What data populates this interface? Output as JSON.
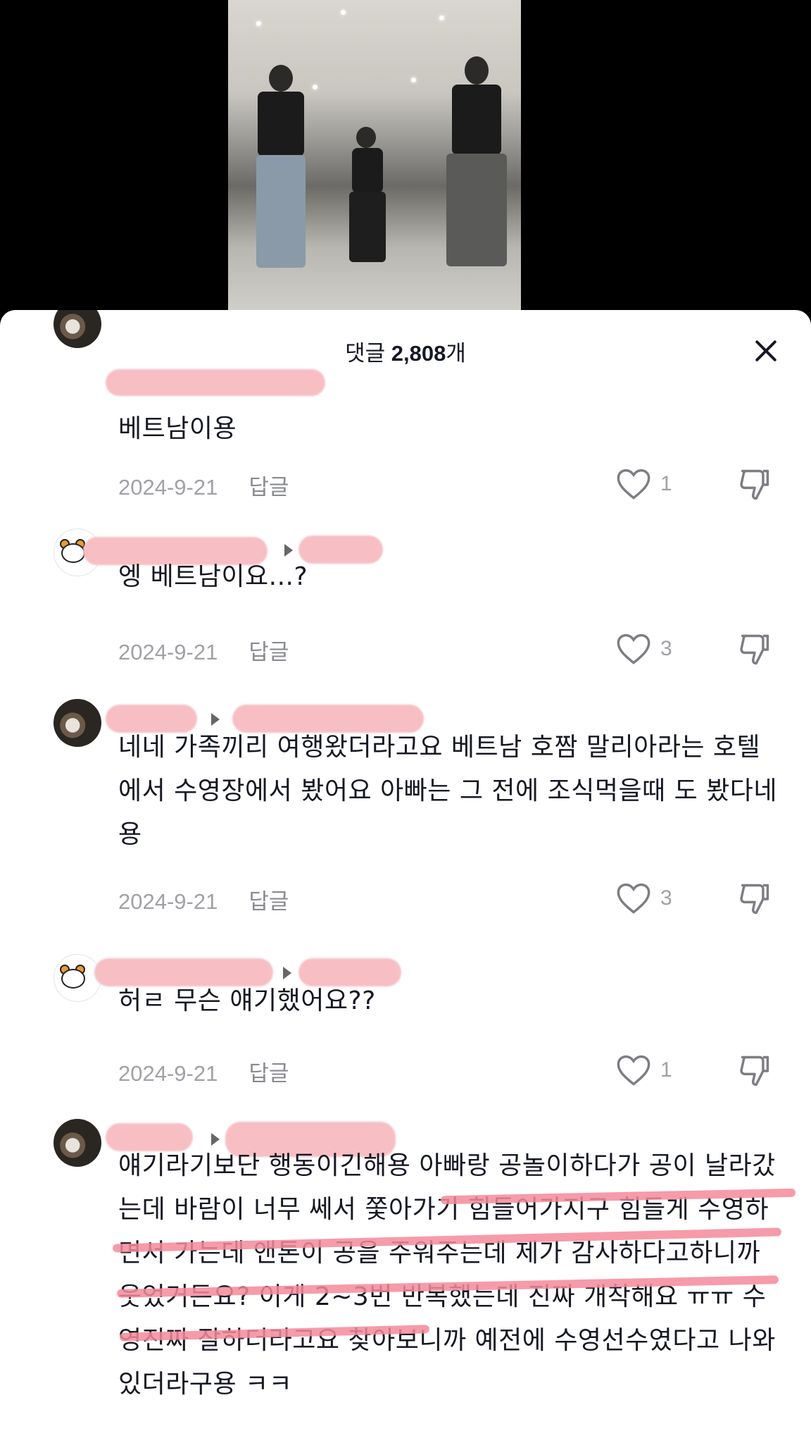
{
  "sheet": {
    "title_prefix": "댓글",
    "title_count": "2,808",
    "title_suffix": "개"
  },
  "icons": {
    "close": "close-icon",
    "like": "heart-icon",
    "dislike": "thumbs-down-icon",
    "reply_arrow": "play-arrow-icon"
  },
  "comments": [
    {
      "text": "베트남이용",
      "date": "2024-9-21",
      "reply_label": "답글",
      "likes": "1"
    },
    {
      "text": "엥 베트남이요...?",
      "date": "2024-9-21",
      "reply_label": "답글",
      "likes": "3"
    },
    {
      "text": "네네 가족끼리 여행왔더라고요 베트남 호짬 말리아라는 호텔에서 수영장에서 봤어요 아빠는 그 전에 조식먹을때 도 봤다네용",
      "date": "2024-9-21",
      "reply_label": "답글",
      "likes": "3"
    },
    {
      "text": "허ㄹ 무슨 얘기했어요??",
      "date": "2024-9-21",
      "reply_label": "답글",
      "likes": "1"
    },
    {
      "text": "얘기라기보단 행동이긴해용 아빠랑 공놀이하다가 공이 날라갔는데 바람이 너무 쎄서 쫓아가기 힘들어가지구 힘들게 수영하면서 가는데 앤톤이 공을 주워주는데 제가 감사하다고하니까 웃었거든요? 이게 2~3번 반복했는데 진짜 개착해요 ㅠㅠ 수영진짜 잘하더라고요 찾아보니까 예전에 수영선수였다고 나와있더라구용 ㅋㅋ"
    }
  ],
  "colors": {
    "redaction": "#f7bfc4",
    "highlight_underline": "#f58a9a",
    "text": "#161823",
    "meta": "#a0a1a6"
  }
}
